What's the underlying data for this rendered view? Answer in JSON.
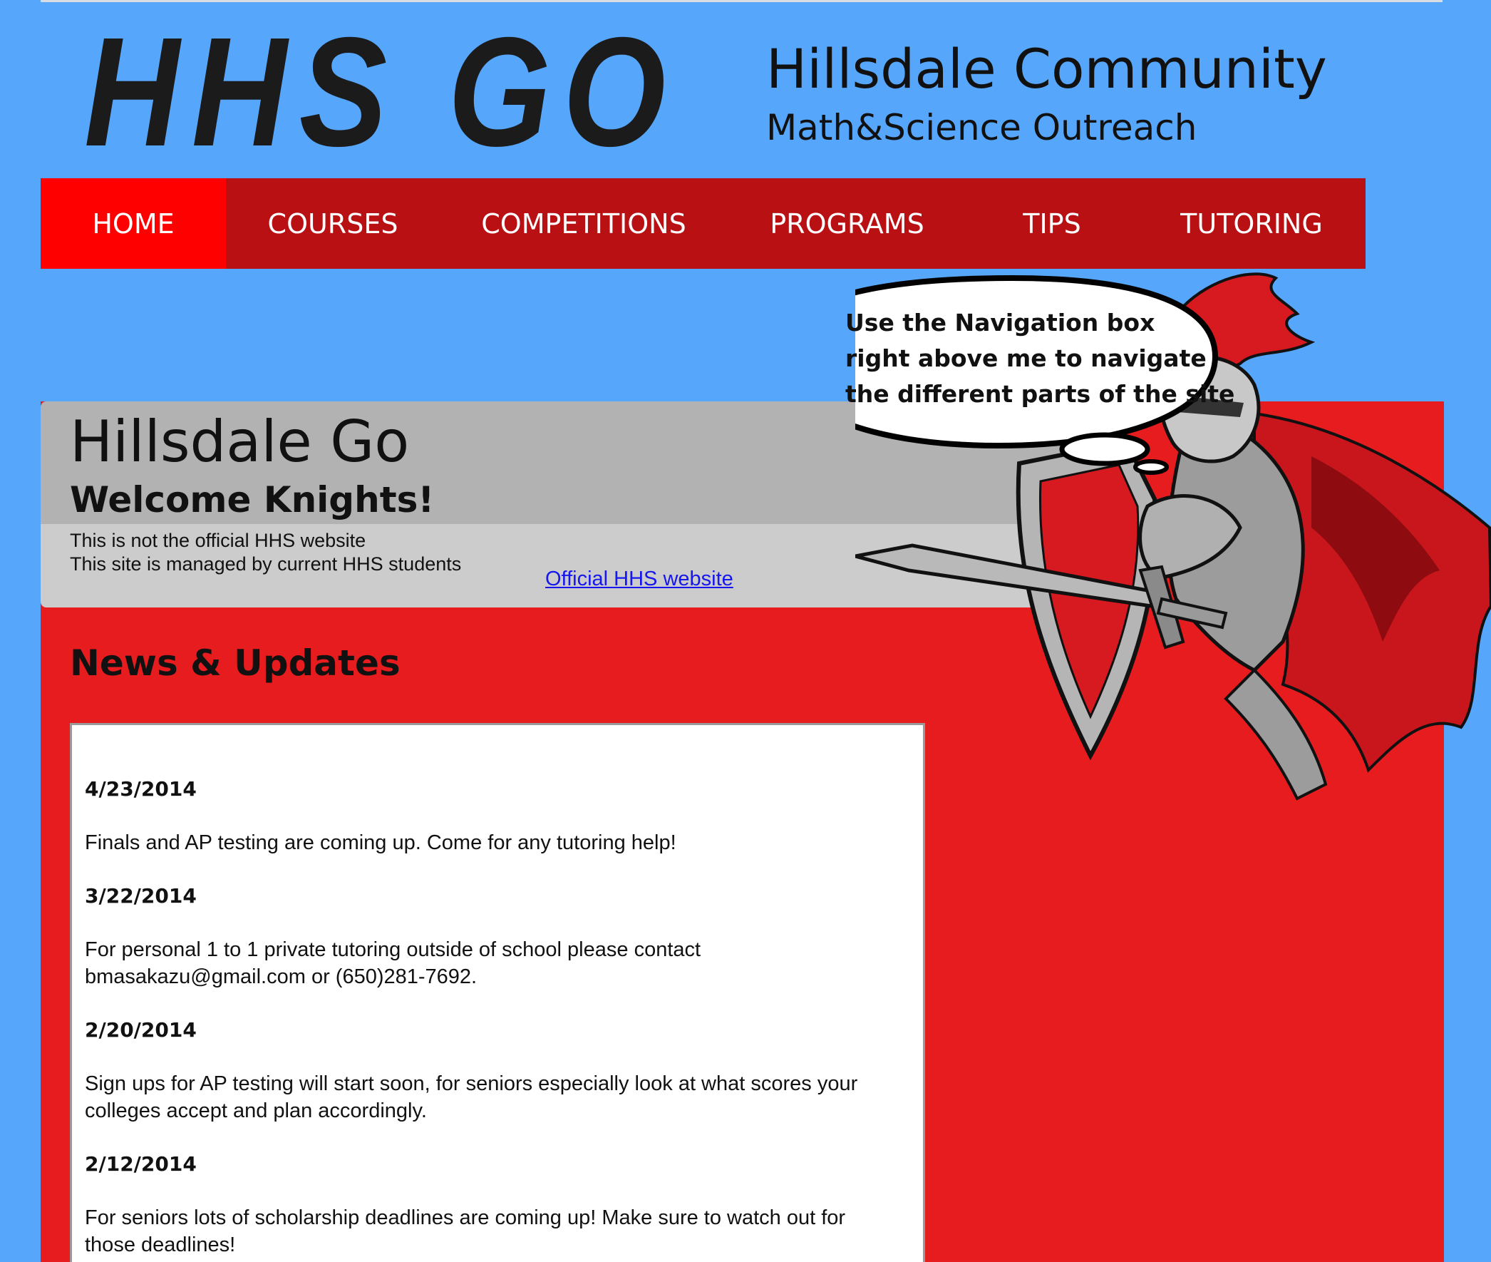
{
  "header": {
    "logo_text": "HHS GO",
    "title": "Hillsdale Community",
    "subtitle": "Math&Science Outreach"
  },
  "nav": {
    "items": [
      {
        "label": "HOME",
        "active": true
      },
      {
        "label": "COURSES",
        "active": false
      },
      {
        "label": "COMPETITIONS",
        "active": false
      },
      {
        "label": "PROGRAMS",
        "active": false
      },
      {
        "label": "TIPS",
        "active": false
      },
      {
        "label": "TUTORING",
        "active": false
      }
    ]
  },
  "mascot": {
    "icon": "knight-mascot-icon",
    "speech_lines": [
      "Use the Navigation box",
      "right above me to navigate",
      "the different parts of the site"
    ]
  },
  "hero": {
    "title": "Hillsdale Go",
    "subtitle": "Welcome Knights!",
    "info_lines": [
      "This is not the official HHS website",
      "This site is managed by current HHS students"
    ],
    "official_link": "Official HHS website"
  },
  "news": {
    "heading": "News & Updates",
    "entries": [
      {
        "date": "4/23/2014",
        "text": "Finals and AP testing are coming up. Come for any tutoring help!"
      },
      {
        "date": "3/22/2014",
        "text": "For personal 1 to 1 private tutoring outside of school please contact bmasakazu@gmail.com or (650)281-7692."
      },
      {
        "date": "2/20/2014",
        "text": "Sign ups for AP testing will start soon, for seniors especially look at what scores your colleges accept and plan accordingly."
      },
      {
        "date": "2/12/2014",
        "text": "For seniors lots of scholarship deadlines are coming up! Make sure to watch out for those deadlines!"
      }
    ]
  },
  "colors": {
    "page_background": "#56a7fc",
    "nav_background": "#b81013",
    "nav_active": "#fe0000",
    "content_red": "#e61c1f",
    "hero_gray": "#b2b2b2",
    "info_gray": "#cccccc",
    "link_blue": "#1616ef"
  }
}
